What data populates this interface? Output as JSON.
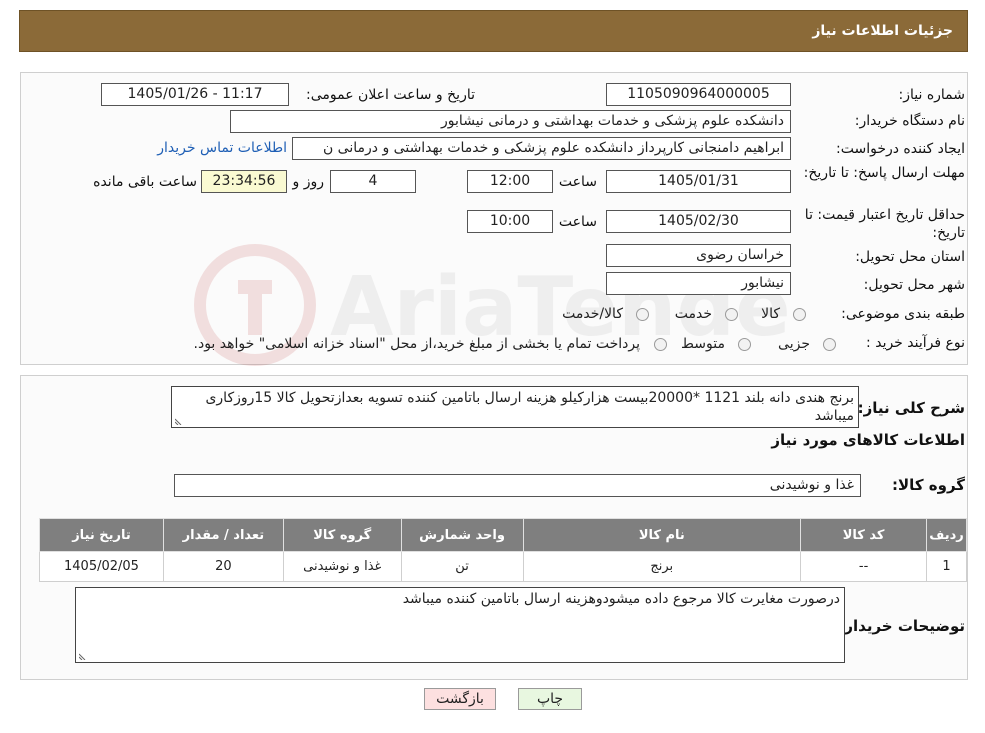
{
  "header": {
    "title": "جزئیات اطلاعات نیاز"
  },
  "form": {
    "need_number": {
      "label": "شماره نیاز:",
      "value": "1105090964000005"
    },
    "announce_datetime": {
      "label": "تاریخ و ساعت اعلان عمومی:",
      "value": "1405/01/26 - 11:17"
    },
    "buyer_org": {
      "label": "نام دستگاه خریدار:",
      "value": "دانشکده علوم پزشکی و خدمات بهداشتی و درمانی نیشابور"
    },
    "requester": {
      "label": "ایجاد کننده درخواست:",
      "value": "ابراهیم دامنجانی  کارپرداز دانشکده علوم پزشکی و خدمات بهداشتی و درمانی ن",
      "contact_link": "اطلاعات تماس خریدار"
    },
    "deadline": {
      "label": "مهلت ارسال پاسخ: تا تاریخ:",
      "date": "1405/01/31",
      "time_label": "ساعت",
      "time": "12:00",
      "days": "4",
      "days_label": "روز و",
      "remaining": "23:34:56",
      "remaining_label": "ساعت باقی مانده"
    },
    "price_validity": {
      "label": "حداقل تاریخ اعتبار قیمت: تا تاریخ:",
      "date": "1405/02/30",
      "time_label": "ساعت",
      "time": "10:00"
    },
    "province": {
      "label": "استان محل تحویل:",
      "value": "خراسان رضوی"
    },
    "city": {
      "label": "شهر محل تحویل:",
      "value": "نیشابور"
    },
    "category": {
      "label": "طبقه بندی موضوعی:",
      "options": [
        "کالا",
        "خدمت",
        "کالا/خدمت"
      ]
    },
    "process": {
      "label": "نوع فرآیند خرید :",
      "options": [
        "جزیی",
        "متوسط"
      ],
      "note": "پرداخت تمام یا بخشی از مبلغ خرید،از محل \"اسناد خزانه اسلامی\" خواهد بود."
    }
  },
  "description": {
    "label": "شرح کلی نیاز:",
    "value": "برنج هندی دانه بلند 1121 *20000بیست هزارکیلو هزینه ارسال باتامین کننده تسویه بعدازتحویل کالا 15روزکاری میباشد"
  },
  "goods_info": {
    "title": "اطلاعات کالاهای مورد نیاز"
  },
  "goods_group": {
    "label": "گروه کالا:",
    "value": "غذا و نوشیدنی"
  },
  "table": {
    "headers": [
      "ردیف",
      "کد کالا",
      "نام کالا",
      "واحد شمارش",
      "گروه کالا",
      "تعداد / مقدار",
      "تاریخ نیاز"
    ],
    "rows": [
      [
        "1",
        "--",
        "برنج",
        "تن",
        "غذا و نوشیدنی",
        "20",
        "1405/02/05"
      ]
    ]
  },
  "buyer_notes": {
    "label": "توضیحات خریدار:",
    "value": "درصورت مغایرت کالا مرجوع داده میشودوهزینه ارسال باتامین کننده میباشد"
  },
  "buttons": {
    "print": "چاپ",
    "back": "بازگشت"
  },
  "watermark": {
    "text": "AriaTender.neT"
  },
  "colors": {
    "header_bg": "#8B6A38",
    "table_header_bg": "#7f7f7f",
    "link": "#1f5fb5",
    "remaining_bg": "#fafad2",
    "back_button_bg": "#fde0e0",
    "print_button_bg": "#e8f7e0"
  }
}
